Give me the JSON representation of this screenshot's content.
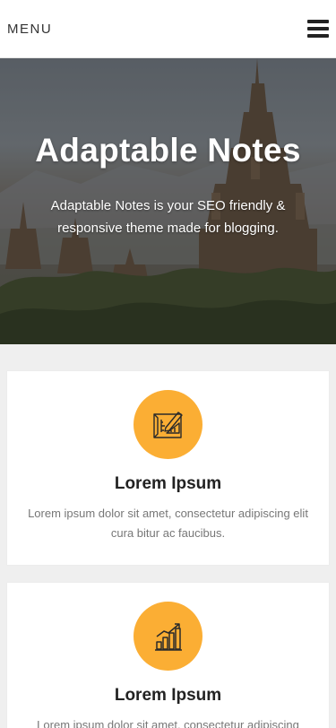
{
  "header": {
    "menu_label": "MENU",
    "hamburger_icon": "hamburger-icon"
  },
  "hero": {
    "title": "Adaptable Notes",
    "subtitle": "Adaptable Notes is your SEO friendly & responsive theme made for blogging."
  },
  "features": [
    {
      "icon": "design-pencil-icon",
      "title": "Lorem Ipsum",
      "text": "Lorem ipsum dolor sit amet, consectetur adipiscing elit cura bitur ac faucibus."
    },
    {
      "icon": "growth-chart-icon",
      "title": "Lorem Ipsum",
      "text": "Lorem ipsum dolor sit amet, consectetur adipiscing"
    }
  ],
  "colors": {
    "accent": "#fbae34",
    "background": "#efefef"
  }
}
